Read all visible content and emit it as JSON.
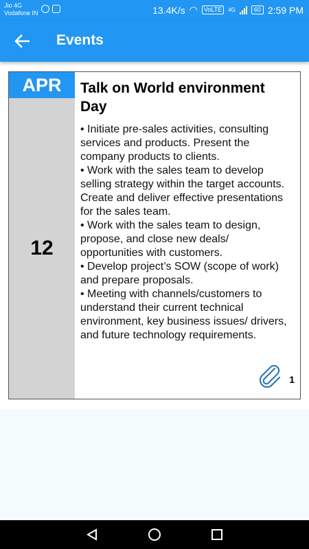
{
  "status_bar": {
    "carrier_line1": "Jio 4G",
    "carrier_line2": "Vodafone IN",
    "speed": "13.4K/s",
    "volte": "VoLTE",
    "network": "4G",
    "battery": "60",
    "time": "2:59 PM"
  },
  "app_bar": {
    "title": "Events",
    "back_icon": "arrow-left-icon",
    "color": "#2196f3"
  },
  "event": {
    "month": "APR",
    "day": "12",
    "title": "Talk on World environment Day",
    "description": [
      "• Initiate pre-sales activities, consulting services and products. Present the company products to clients.",
      "• Work with the sales team to develop selling strategy within the target accounts. Create and deliver effective presentations for the sales team.",
      "• Work with the sales team to design, propose, and close new deals/ opportunities with customers.",
      "• Develop project’s SOW (scope of work) and prepare proposals.",
      "• Meeting with channels/customers to understand their current technical environment, key business issues/ drivers, and future technology requirements."
    ],
    "attachment_icon": "paperclip-icon",
    "attachment_count": "1"
  },
  "nav_bar": {
    "back_icon": "triangle-back-icon",
    "home_icon": "circle-home-icon",
    "recents_icon": "square-recents-icon"
  }
}
